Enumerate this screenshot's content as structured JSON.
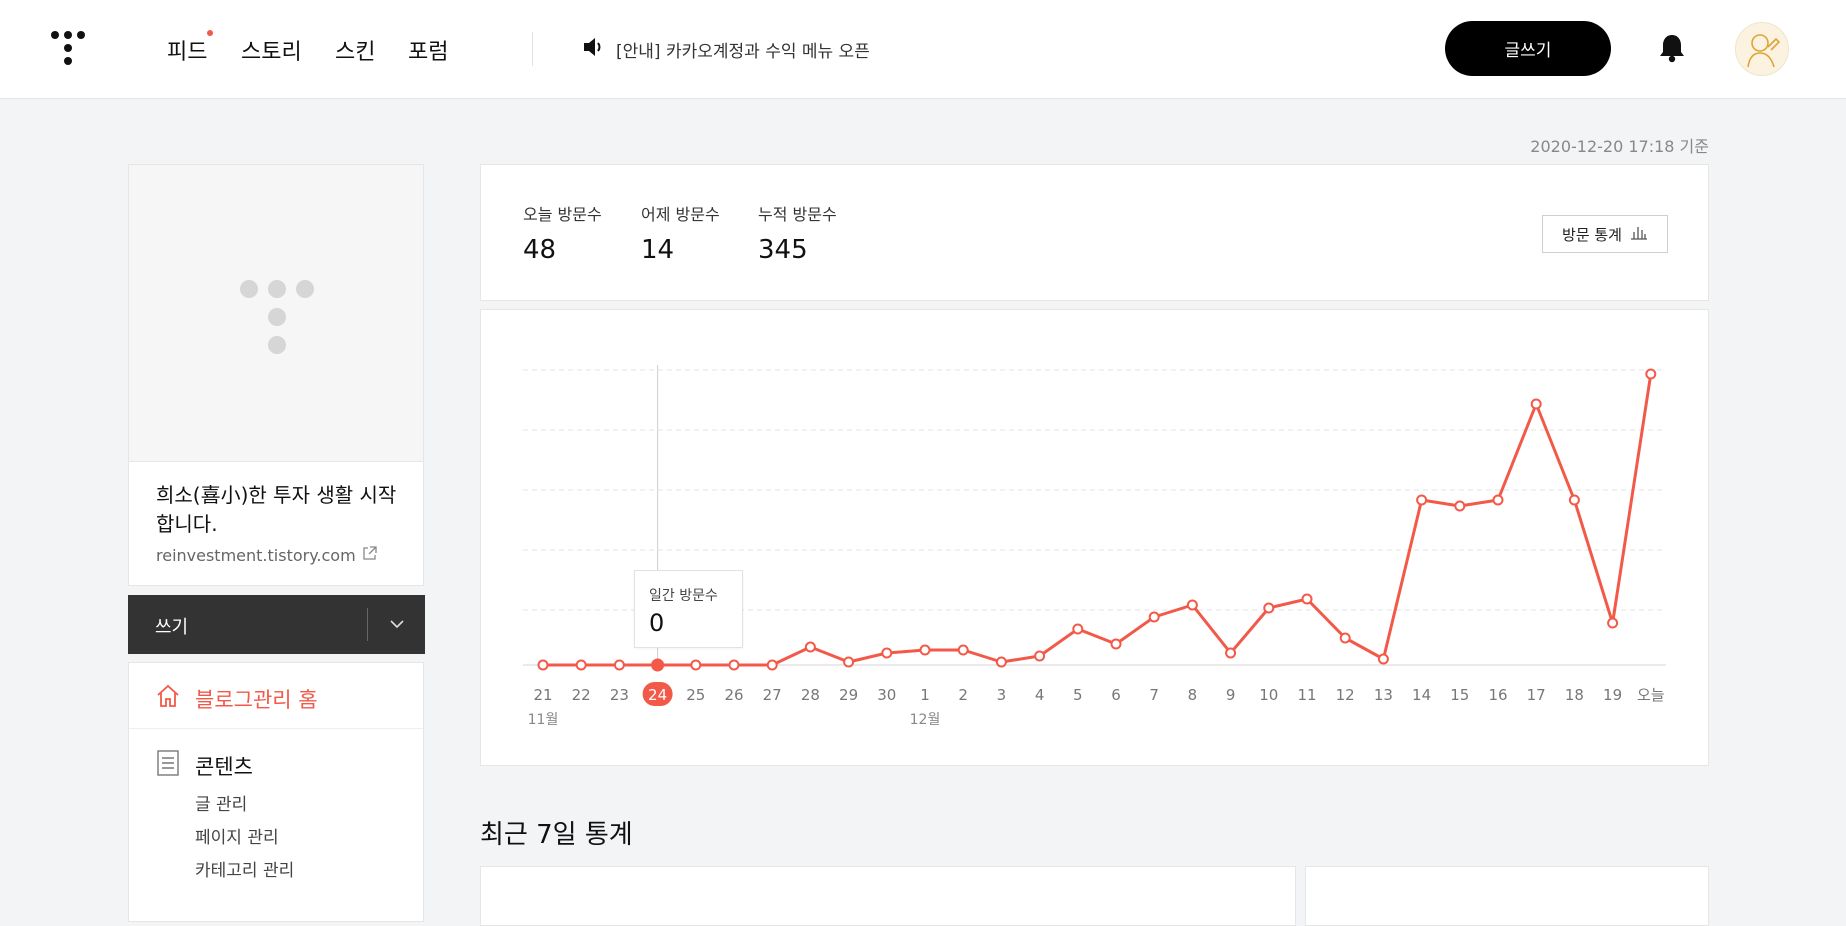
{
  "header": {
    "nav": [
      {
        "label": "피드",
        "has_dot": true
      },
      {
        "label": "스토리",
        "has_dot": false
      },
      {
        "label": "스킨",
        "has_dot": false
      },
      {
        "label": "포럼",
        "has_dot": false
      }
    ],
    "notice": "[안내] 카카오계정과 수익 메뉴 오픈",
    "write_button": "글쓰기",
    "accent_color": "#f35949"
  },
  "basis_time": "2020-12-20 17:18 기준",
  "sidebar": {
    "blog_title": "희소(喜小)한 투자 생활 시작합니다.",
    "blog_url": "reinvestment.tistory.com",
    "write_label": "쓰기",
    "menu_home": "블로그관리 홈",
    "menu_section": "콘텐츠",
    "menu_items": [
      "글 관리",
      "페이지 관리",
      "카테고리 관리"
    ]
  },
  "stats": {
    "today_label": "오늘 방문수",
    "today_value": "48",
    "yesterday_label": "어제 방문수",
    "yesterday_value": "14",
    "total_label": "누적 방문수",
    "total_value": "345",
    "button": "방문 통계"
  },
  "tooltip": {
    "label": "일간 방문수",
    "value": "0"
  },
  "section_title": "최근 7일 통계",
  "chart_data": {
    "type": "line",
    "categories": [
      "21",
      "22",
      "23",
      "24",
      "25",
      "26",
      "27",
      "28",
      "29",
      "30",
      "1",
      "2",
      "3",
      "4",
      "5",
      "6",
      "7",
      "8",
      "9",
      "10",
      "11",
      "12",
      "13",
      "14",
      "15",
      "16",
      "17",
      "18",
      "19",
      "오늘"
    ],
    "month_labels": [
      {
        "index": 0,
        "label": "11월"
      },
      {
        "index": 10,
        "label": "12월"
      }
    ],
    "series": [
      {
        "values": [
          0,
          0,
          0,
          0,
          0,
          0,
          0,
          6,
          1,
          4,
          5,
          5,
          1,
          3,
          12,
          7,
          16,
          20,
          4,
          19,
          22,
          9,
          2,
          55,
          53,
          55,
          87,
          55,
          14,
          97
        ]
      }
    ],
    "ylim": [
      0,
      100
    ],
    "highlight_index": 3,
    "grid": "horizontal-dashed",
    "line_color": "#f35949"
  }
}
